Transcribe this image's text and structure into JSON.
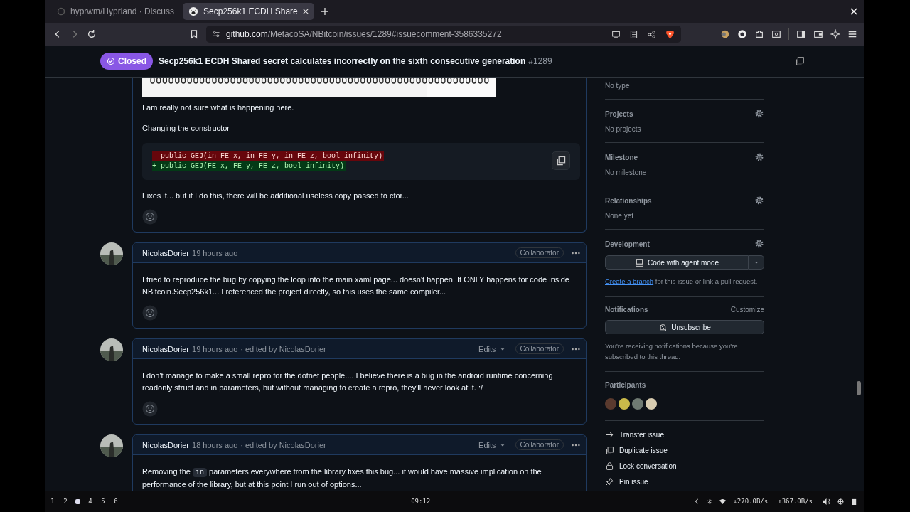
{
  "browser": {
    "tabs": [
      {
        "title": "hyprwm/Hyprland · Discuss",
        "selected": false
      },
      {
        "title": "Secp256k1 ECDH Share",
        "selected": true
      }
    ],
    "address": {
      "domain": "github.com",
      "path": "/MetacoSA/NBitcoin/issues/1289#issuecomment-3586335272"
    }
  },
  "issue_header": {
    "state": "Closed",
    "title": "Secp256k1 ECDH Shared secret calculates incorrectly on the sixth consecutive generation",
    "number": "#1289"
  },
  "first_comment": {
    "picture": {
      "kind": "picture"
    },
    "paragraphs_before": [
      "I am really not sure what is happening here.",
      "Changing the constructor"
    ],
    "diff": [
      {
        "kind": "removed",
        "text": "- public GEJ(in FE x, in FE y, in FE z, bool infinity)"
      },
      {
        "kind": "added",
        "text": "+ public GEJ(FE x, FE y, FE z, bool infinity)"
      }
    ],
    "paragraphs_after": [
      "Fixes it... but if I do this, there will be additional useless copy passed to ctor..."
    ]
  },
  "comments": [
    {
      "author": "NicolasDorier",
      "time": "19 hours ago",
      "role": "Collaborator",
      "body": [
        {
          "kind": "text",
          "text": "I tried to reproduce the bug by copying the loop into the main xaml page... doesn't happen. It ONLY happens for code inside NBitcoin.Secp256k1... I referenced the project directly, so this uses the same compiler..."
        }
      ],
      "reactions": true
    },
    {
      "author": "NicolasDorier",
      "time": "19 hours ago",
      "edited": "· edited by NicolasDorier",
      "edits": "Edits",
      "role": "Collaborator",
      "body": [
        {
          "kind": "text",
          "text": "I don't manage to make a small repro for the dotnet people.... I believe there is a bug in the android runtime concerning readonly struct and in parameters, but without managing to create a repro, they'll never look at it. :/"
        }
      ],
      "reactions": true
    },
    {
      "author": "NicolasDorier",
      "time": "18 hours ago",
      "edited": "· edited by NicolasDorier",
      "edits": "Edits",
      "role": "Collaborator",
      "body": [
        {
          "kind": "text",
          "text": "Removing the "
        },
        {
          "kind": "code",
          "text": "in"
        },
        {
          "kind": "text",
          "text": " parameters everywhere from the library fixes this bug... it would have massive implication on the performance of the library, but at this point I run out of options..."
        }
      ],
      "reactions": false
    }
  ],
  "sidebar": {
    "type_value": "No type",
    "sections": [
      {
        "title": "Projects",
        "value": "No projects"
      },
      {
        "title": "Milestone",
        "value": "No milestone"
      },
      {
        "title": "Relationships",
        "value": "None yet"
      }
    ],
    "development": {
      "title": "Development",
      "button": "Code with agent mode",
      "link": "Create a branch",
      "link_rest": " for this issue or link a pull request."
    },
    "notifications": {
      "title": "Notifications",
      "customize": "Customize",
      "button": "Unsubscribe",
      "note": "You're receiving notifications because you're subscribed to this thread."
    },
    "participants": {
      "title": "Participants",
      "avatars": [
        {
          "color": "#5a3a2e"
        },
        {
          "color": "#c9b94a"
        },
        {
          "color": "#6f7a72"
        },
        {
          "color": "#d8ccb0"
        }
      ]
    },
    "actions": [
      {
        "kind": "transfer",
        "label": "Transfer issue"
      },
      {
        "kind": "duplicate",
        "label": "Duplicate issue"
      },
      {
        "kind": "lock",
        "label": "Lock conversation"
      },
      {
        "kind": "pin",
        "label": "Pin issue"
      }
    ]
  },
  "status_bar": {
    "workspaces": [
      {
        "label": "1",
        "selected": false
      },
      {
        "label": "2",
        "selected": false
      },
      {
        "selected": true
      },
      {
        "label": "4",
        "selected": false
      },
      {
        "label": "5",
        "selected": false
      },
      {
        "label": "6",
        "selected": false
      }
    ],
    "clock": "09:12",
    "download": "↓270.0B/s",
    "upload": "↑367.0B/s"
  }
}
